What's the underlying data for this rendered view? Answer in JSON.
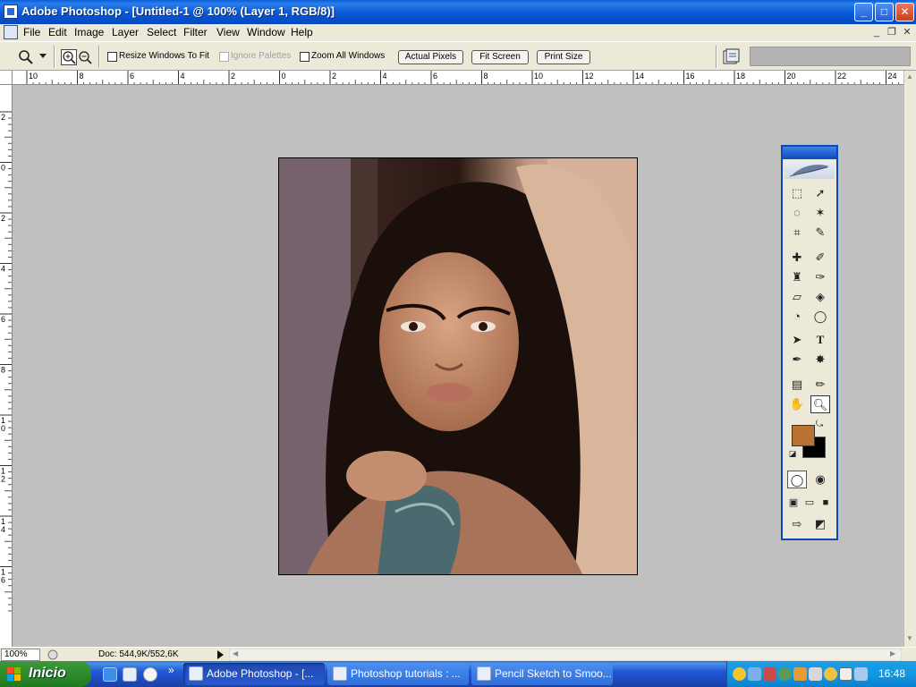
{
  "window": {
    "title": "Adobe Photoshop - [Untitled-1 @ 100% (Layer 1, RGB/8)]",
    "controls": {
      "minimize": "_",
      "maximize": "□",
      "close": "✕"
    }
  },
  "menu": {
    "items": [
      "File",
      "Edit",
      "Image",
      "Layer",
      "Select",
      "Filter",
      "View",
      "Window",
      "Help"
    ],
    "doc_controls": {
      "minimize": "_",
      "restore": "❐",
      "close": "✕"
    }
  },
  "options_bar": {
    "resize_windows": {
      "label": "Resize Windows To Fit",
      "checked": false
    },
    "ignore_palettes": {
      "label": "Ignore Palettes",
      "checked": false,
      "enabled": false
    },
    "zoom_all": {
      "label": "Zoom All Windows",
      "checked": false
    },
    "buttons": {
      "actual_pixels": "Actual Pixels",
      "fit_screen": "Fit Screen",
      "print_size": "Print Size"
    }
  },
  "rulers": {
    "top_labels": [
      "10",
      "8",
      "6",
      "4",
      "2",
      "0",
      "2",
      "4",
      "6",
      "8",
      "10",
      "12",
      "14",
      "16",
      "18",
      "20",
      "22",
      "24"
    ],
    "left_labels": [
      "2",
      "0",
      "2",
      "4",
      "6",
      "8",
      "1 0",
      "1 2",
      "1 4",
      "1 6"
    ]
  },
  "status": {
    "zoom": "100%",
    "doc": "Doc: 544,9K/552,6K"
  },
  "tools": {
    "foreground_color": "#b87333",
    "background_color": "#000000",
    "active_tool": "zoom"
  },
  "taskbar": {
    "start_label": "Inicio",
    "overflow": "»",
    "tasks": [
      {
        "label": "Adobe Photoshop - [...",
        "active": true
      },
      {
        "label": "Photoshop tutorials : ...",
        "active": false
      },
      {
        "label": "Pencil Sketch to Smoo...",
        "active": false
      }
    ],
    "clock": "16:48"
  },
  "colors": {
    "title_bar": "#0858d8",
    "chrome": "#ece9d8",
    "workspace": "#c0c0c0",
    "taskbar": "#2157d7",
    "start_button": "#2d8b2d",
    "tray": "#129ae0"
  }
}
